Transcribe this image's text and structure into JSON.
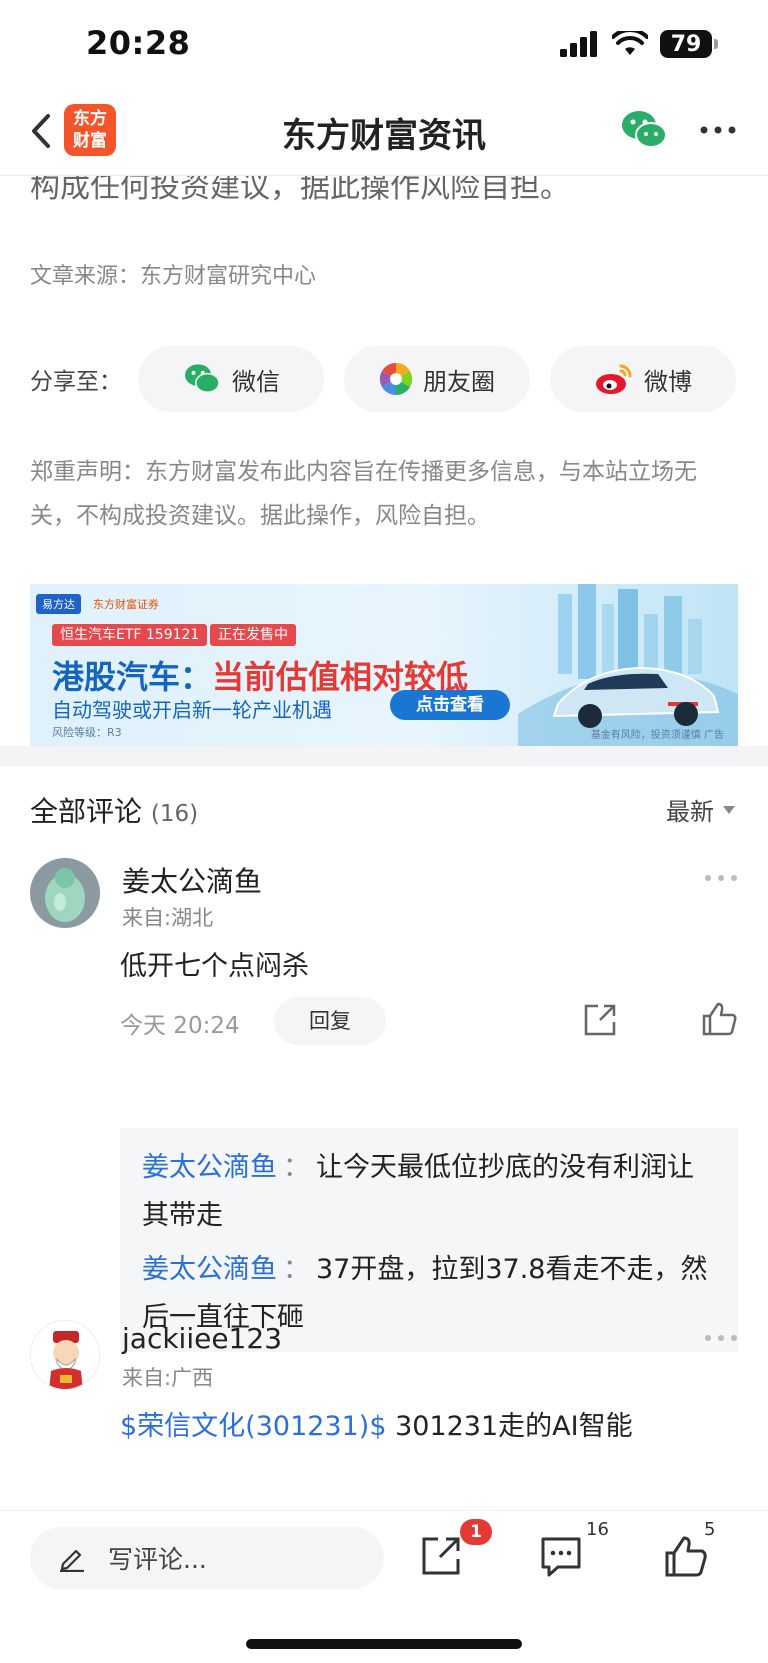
{
  "status_bar": {
    "time": "20:28",
    "battery": "79"
  },
  "header": {
    "back_icon": "chevron-left-icon",
    "logo_text_line1": "东方",
    "logo_text_line2": "财富",
    "title": "东方财富资讯",
    "wechat_icon": "wechat-icon",
    "more_icon": "more-horizontal-icon"
  },
  "article": {
    "cut_text": "构成任何投资建议，据此操作风险自担。",
    "source": "文章来源：东方财富研究中心",
    "share_label": "分享至：",
    "share_buttons": [
      {
        "label": "微信",
        "icon": "wechat-icon"
      },
      {
        "label": "朋友圈",
        "icon": "moments-icon"
      },
      {
        "label": "微博",
        "icon": "weibo-icon"
      }
    ],
    "disclaimer": "郑重声明：东方财富发布此内容旨在传播更多信息，与本站立场无关，不构成投资建议。据此操作，风险自担。"
  },
  "ad": {
    "logo_left": "易方达",
    "logo_right": "东方财富证券",
    "tag1": "恒生汽车ETF 159121",
    "tag2": "正在发售中",
    "headline_part1": "港股汽车：",
    "headline_part2": "当前估值相对较低",
    "subline": "自动驾驶或开启新一轮产业机遇",
    "cta": "点击查看",
    "risk": "风险等级：R3",
    "note": "基金有风险，投资须谨慎 广告",
    "colors": {
      "blue": "#1565c0",
      "red": "#e53935"
    }
  },
  "comments": {
    "title": "全部评论",
    "count": "(16)",
    "sort_label": "最新",
    "items": [
      {
        "user": "姜太公滴鱼",
        "location": "来自:湖北",
        "text": "低开七个点闷杀",
        "time": "今天 20:24",
        "reply_label": "回复",
        "replies": [
          {
            "user": "姜太公滴鱼",
            "colon": "：",
            "text": "让今天最低位抄底的没有利润让其带走"
          },
          {
            "user": "姜太公滴鱼",
            "colon": "：",
            "text": "37开盘，拉到37.8看走不走，然后一直往下砸"
          }
        ]
      },
      {
        "user": "jackiiee123",
        "location": "来自:广西",
        "text_link": "$荣信文化(301231)$",
        "text": " 301231走的AI智能"
      }
    ]
  },
  "bottom_bar": {
    "input_placeholder": "写评论...",
    "share_badge": "1",
    "comment_count": "16",
    "like_count": "5"
  }
}
